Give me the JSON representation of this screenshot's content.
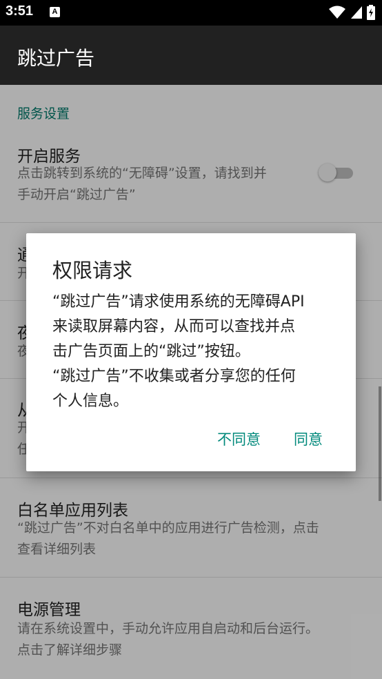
{
  "status_bar": {
    "time": "3:51",
    "notification_icon": "accessibility-a-icon",
    "icons": [
      "wifi-icon",
      "signal-icon",
      "battery-icon"
    ]
  },
  "app_bar": {
    "title": "跳过广告"
  },
  "settings": {
    "section_header": "服务设置",
    "items": [
      {
        "title": "开启服务",
        "summary_lines": [
          "点击跳转到系统的“无障碍”设置，请找到并",
          "手动开启“跳过广告”"
        ],
        "toggle_on": false
      },
      {
        "title": "通",
        "summary_lines": [
          "开"
        ]
      },
      {
        "title": "夜",
        "summary_lines": [
          "夜"
        ]
      },
      {
        "title": "从",
        "summary_lines": [
          "开",
          "任"
        ]
      },
      {
        "title": "白名单应用列表",
        "summary_lines": [
          "“跳过广告”不对白名单中的应用进行广告检测，点击",
          "查看详细列表"
        ]
      },
      {
        "title": "电源管理",
        "summary_lines": [
          "请在系统设置中，手动允许应用自启动和后台运行。",
          "点击了解详细步骤"
        ]
      }
    ]
  },
  "dialog": {
    "title": "权限请求",
    "message_lines": [
      "“跳过广告”请求使用系统的无障碍API",
      "来读取屏幕内容，从而可以查找并点",
      "击广告页面上的“跳过”按钮。",
      "“跳过广告”不收集或者分享您的任何",
      "个人信息。"
    ],
    "negative_button": "不同意",
    "positive_button": "同意"
  },
  "colors": {
    "accent": "#00897b",
    "section_header": "#00796b",
    "app_bar": "#212121",
    "status_bar": "#000000"
  }
}
